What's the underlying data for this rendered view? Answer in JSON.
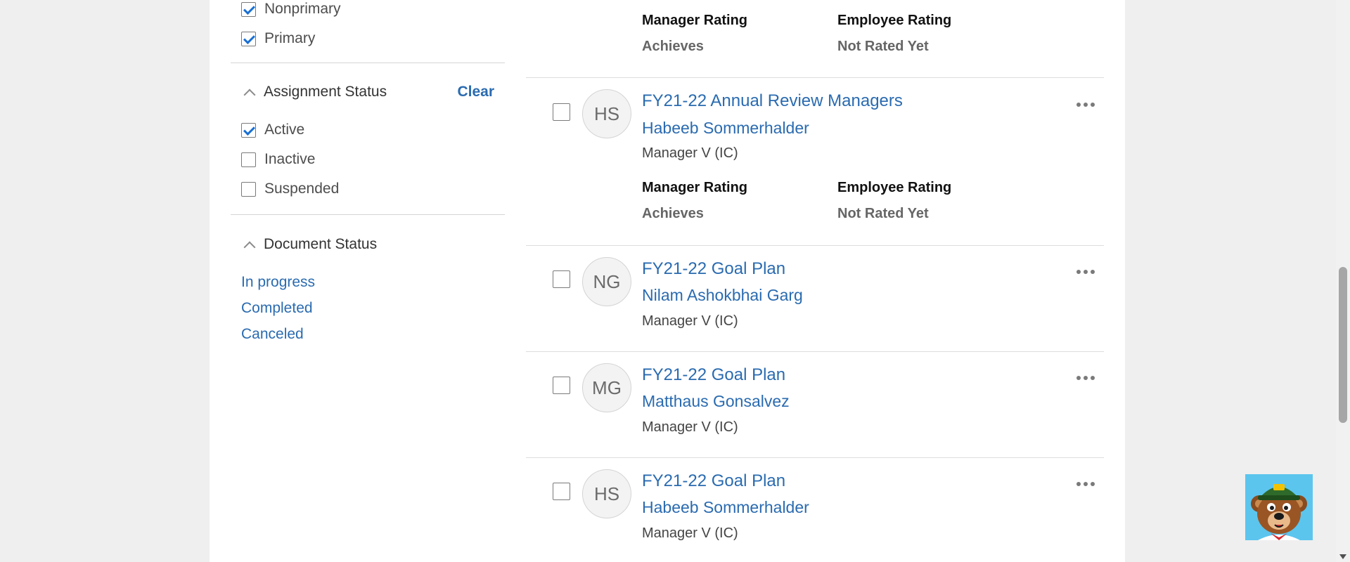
{
  "filters": {
    "work_type_items": [
      {
        "label": "Nonprimary",
        "checked": true
      },
      {
        "label": "Primary",
        "checked": true
      }
    ],
    "assignment_status": {
      "title": "Assignment Status",
      "clear_label": "Clear",
      "items": [
        {
          "label": "Active",
          "checked": true
        },
        {
          "label": "Inactive",
          "checked": false
        },
        {
          "label": "Suspended",
          "checked": false
        }
      ]
    },
    "document_status": {
      "title": "Document Status",
      "links": [
        "In progress",
        "Completed",
        "Canceled"
      ]
    }
  },
  "results": {
    "partial_row": {
      "manager_rating_label": "Manager Rating",
      "manager_rating_value": "Achieves",
      "employee_rating_label": "Employee Rating",
      "employee_rating_value": "Not Rated Yet"
    },
    "rows": [
      {
        "initials": "HS",
        "title": "FY21-22 Annual Review Managers",
        "name": "Habeeb Sommerhalder",
        "job": "Manager V (IC)",
        "manager_rating_label": "Manager Rating",
        "manager_rating_value": "Achieves",
        "employee_rating_label": "Employee Rating",
        "employee_rating_value": "Not Rated Yet"
      },
      {
        "initials": "NG",
        "title": "FY21-22 Goal Plan",
        "name": "Nilam Ashokbhai Garg",
        "job": "Manager V (IC)"
      },
      {
        "initials": "MG",
        "title": "FY21-22 Goal Plan",
        "name": "Matthaus Gonsalvez",
        "job": "Manager V (IC)"
      },
      {
        "initials": "HS",
        "title": "FY21-22 Goal Plan",
        "name": "Habeeb Sommerhalder",
        "job": "Manager V (IC)"
      }
    ]
  },
  "colors": {
    "link": "#2a6bb0",
    "checkbox_checked": "#1a6fd3",
    "mascot_bg": "#5bc5ee"
  }
}
